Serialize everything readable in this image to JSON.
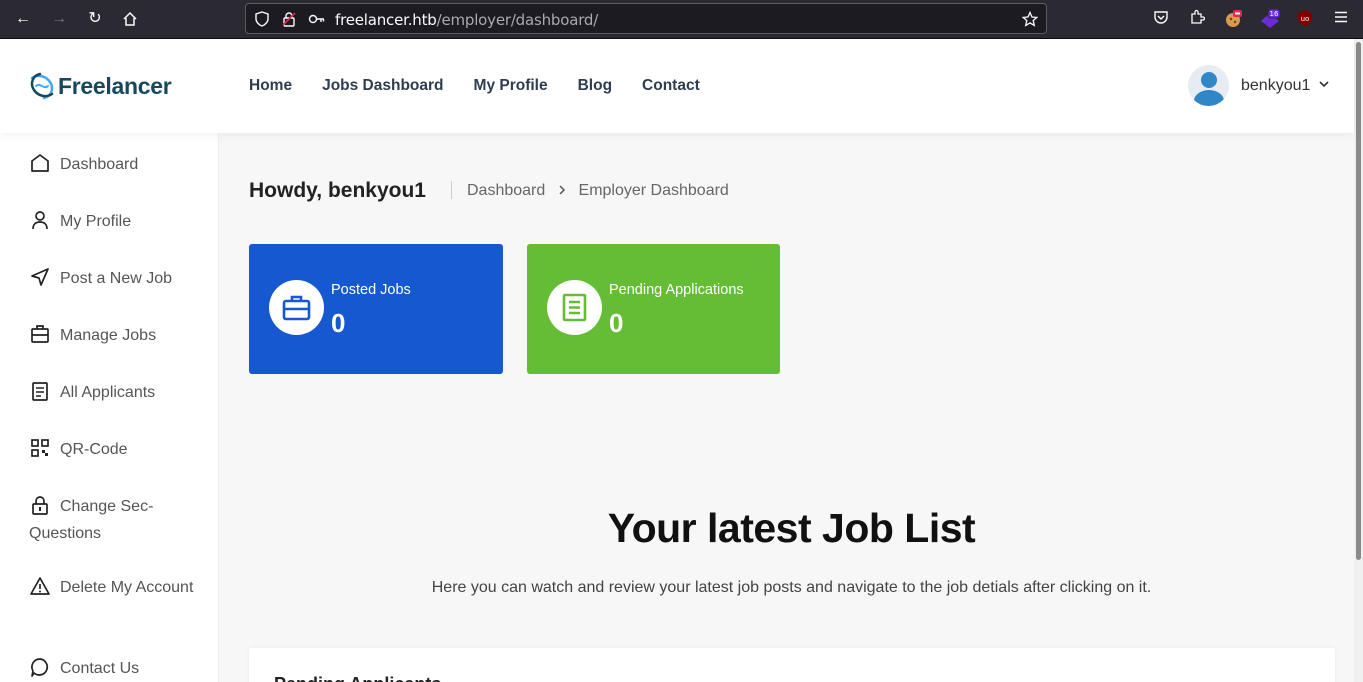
{
  "browser": {
    "url_host": "freelancer.htb",
    "url_path": "/employer/dashboard/",
    "ext_badge": "16"
  },
  "header": {
    "logo_text": "Freelancer",
    "nav": [
      "Home",
      "Jobs Dashboard",
      "My Profile",
      "Blog",
      "Contact"
    ],
    "username": "benkyou1"
  },
  "sidebar": {
    "items": [
      {
        "label": "Dashboard",
        "icon": "home-icon"
      },
      {
        "label": "My Profile",
        "icon": "user-icon"
      },
      {
        "label": "Post a New Job",
        "icon": "send-icon"
      },
      {
        "label": "Manage Jobs",
        "icon": "briefcase-icon"
      },
      {
        "label": "All Applicants",
        "icon": "document-icon"
      },
      {
        "label": "QR-Code",
        "icon": "qr-code-icon"
      },
      {
        "label": "Change Sec-Questions",
        "icon": "lock-icon"
      },
      {
        "label": "Delete My Account",
        "icon": "warning-icon"
      },
      {
        "label": "Contact Us",
        "icon": "chat-icon"
      }
    ]
  },
  "main": {
    "greeting": "Howdy, benkyou1",
    "breadcrumb": [
      "Dashboard",
      "Employer Dashboard"
    ],
    "stats": [
      {
        "label": "Posted Jobs",
        "value": "0",
        "color": "#1558d0"
      },
      {
        "label": "Pending Applications",
        "value": "0",
        "color": "#65bc35"
      }
    ],
    "section_title": "Your latest Job List",
    "section_subtitle": "Here you can watch and review your latest job posts and navigate to the job detials after clicking on it.",
    "card_title": "Pending Applicants"
  }
}
